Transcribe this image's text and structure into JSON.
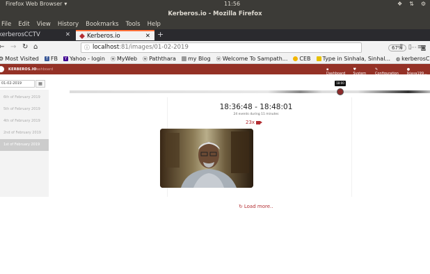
{
  "os": {
    "app_name": "Firefox Web Browser",
    "clock": "11:56"
  },
  "window": {
    "title": "Kerberos.io - Mozilla Firefox"
  },
  "menu": [
    "File",
    "Edit",
    "View",
    "History",
    "Bookmarks",
    "Tools",
    "Help"
  ],
  "tabs": [
    {
      "label": "kerberosCCTV",
      "active": false
    },
    {
      "label": "Kerberos.io",
      "active": true
    }
  ],
  "url": {
    "host": "localhost",
    "path": ":81/images/01-02-2019",
    "zoom": "67%"
  },
  "bookmarks": [
    {
      "label": "Most Visited",
      "icon": "gear-icon"
    },
    {
      "label": "FB",
      "icon": "facebook-icon"
    },
    {
      "label": "Yahoo - login",
      "icon": "yahoo-icon"
    },
    {
      "label": "MyWeb",
      "icon": "web-icon"
    },
    {
      "label": "Paththara",
      "icon": "web-icon"
    },
    {
      "label": "my Blog",
      "icon": "blog-icon"
    },
    {
      "label": "Welcome To Sampath...",
      "icon": "web-icon"
    },
    {
      "label": "CEB",
      "icon": "ceb-icon"
    },
    {
      "label": "Type in Sinhala, Sinhal...",
      "icon": "helakuru-icon"
    },
    {
      "label": "kerberosCCTV",
      "icon": "globe-icon"
    }
  ],
  "app": {
    "brand": "KERBEROS.IO",
    "brand_sub": "Dashboard",
    "nav": [
      "Dashboard",
      "System",
      "Configuration",
      "lkjaya199..."
    ],
    "date_value": "01-02-2019",
    "days": [
      {
        "label": "6th of February 2019",
        "active": false
      },
      {
        "label": "5th of February 2019",
        "active": false
      },
      {
        "label": "4th of February 2019",
        "active": false
      },
      {
        "label": "2nd of February 2019",
        "active": false
      },
      {
        "label": "1st of February 2019",
        "active": true
      }
    ],
    "timeline_tooltip": "18:00",
    "event": {
      "time_range": "18:36:48 - 18:48:01",
      "summary": "24 events during 11 minutes",
      "count": "23x"
    },
    "load_more": "Load more.."
  }
}
